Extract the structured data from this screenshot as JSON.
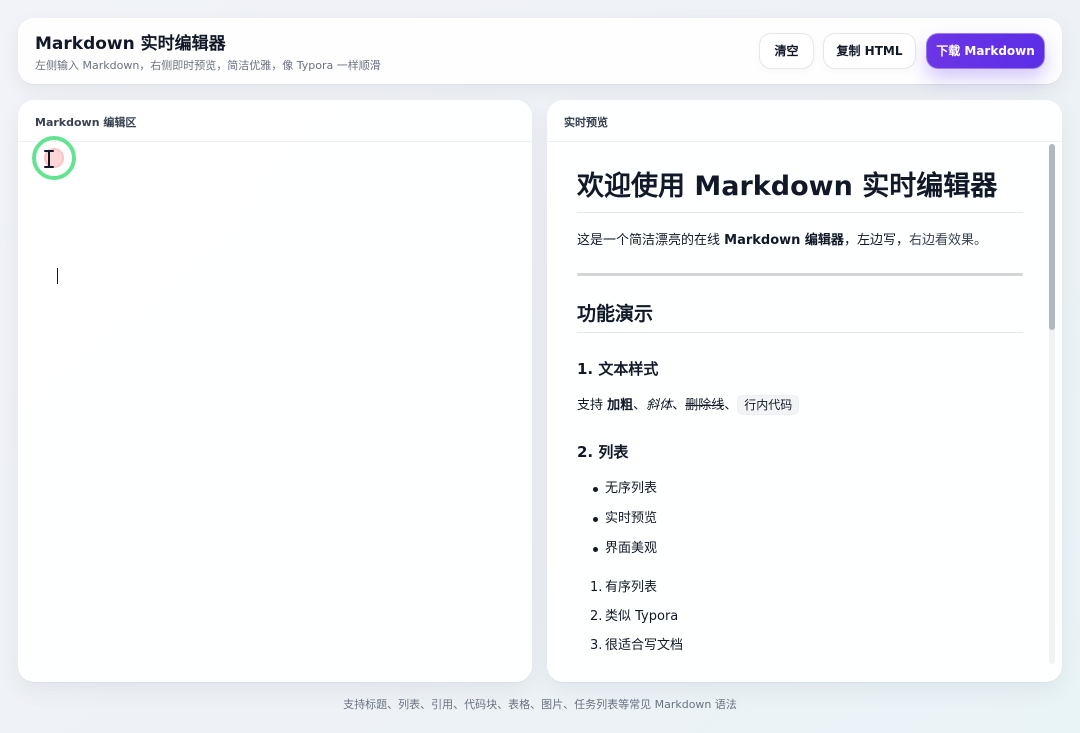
{
  "app": {
    "title": "Markdown 实时编辑器",
    "subtitle": "左侧输入 Markdown，右侧即时预览，简洁优雅，像 Typora 一样顺滑"
  },
  "toolbar": {
    "clear_label": "清空",
    "copy_html_label": "复制 HTML",
    "download_label": "下载 Markdown"
  },
  "editor": {
    "label": "Markdown 编辑区",
    "value": "",
    "placeholder": ""
  },
  "preview": {
    "label": "实时预览",
    "content": {
      "h1": "欢迎使用 Markdown 实时编辑器",
      "intro": {
        "prefix": "这是一个简洁漂亮的在线 ",
        "strong": "Markdown 编辑器",
        "suffix_a": "，左边写，",
        "suffix_b": "右边看效果。"
      },
      "h2": "功能演示",
      "section_text_styles": "1. 文本样式",
      "style_line": {
        "prefix": "支持 ",
        "bold": "加粗",
        "sep1": "、",
        "italic": "斜体",
        "sep2": "、",
        "strike": "删除线",
        "sep3": "、",
        "code": "行内代码"
      },
      "section_lists": "2. 列表",
      "ul": [
        "无序列表",
        "实时预览",
        "界面美观"
      ],
      "ol": [
        "有序列表",
        "类似 Typora",
        "很适合写文档"
      ]
    },
    "scroll": {
      "position": 0.0
    }
  },
  "footer": {
    "text": "支持标题、列表、引用、代码块、表格、图片、任务列表等常见 Markdown 语法"
  },
  "icons": {
    "cursor": "text-cursor-icon"
  },
  "colors": {
    "primary": "#5b2ee6",
    "text": "#111827",
    "muted": "#6b7280"
  }
}
